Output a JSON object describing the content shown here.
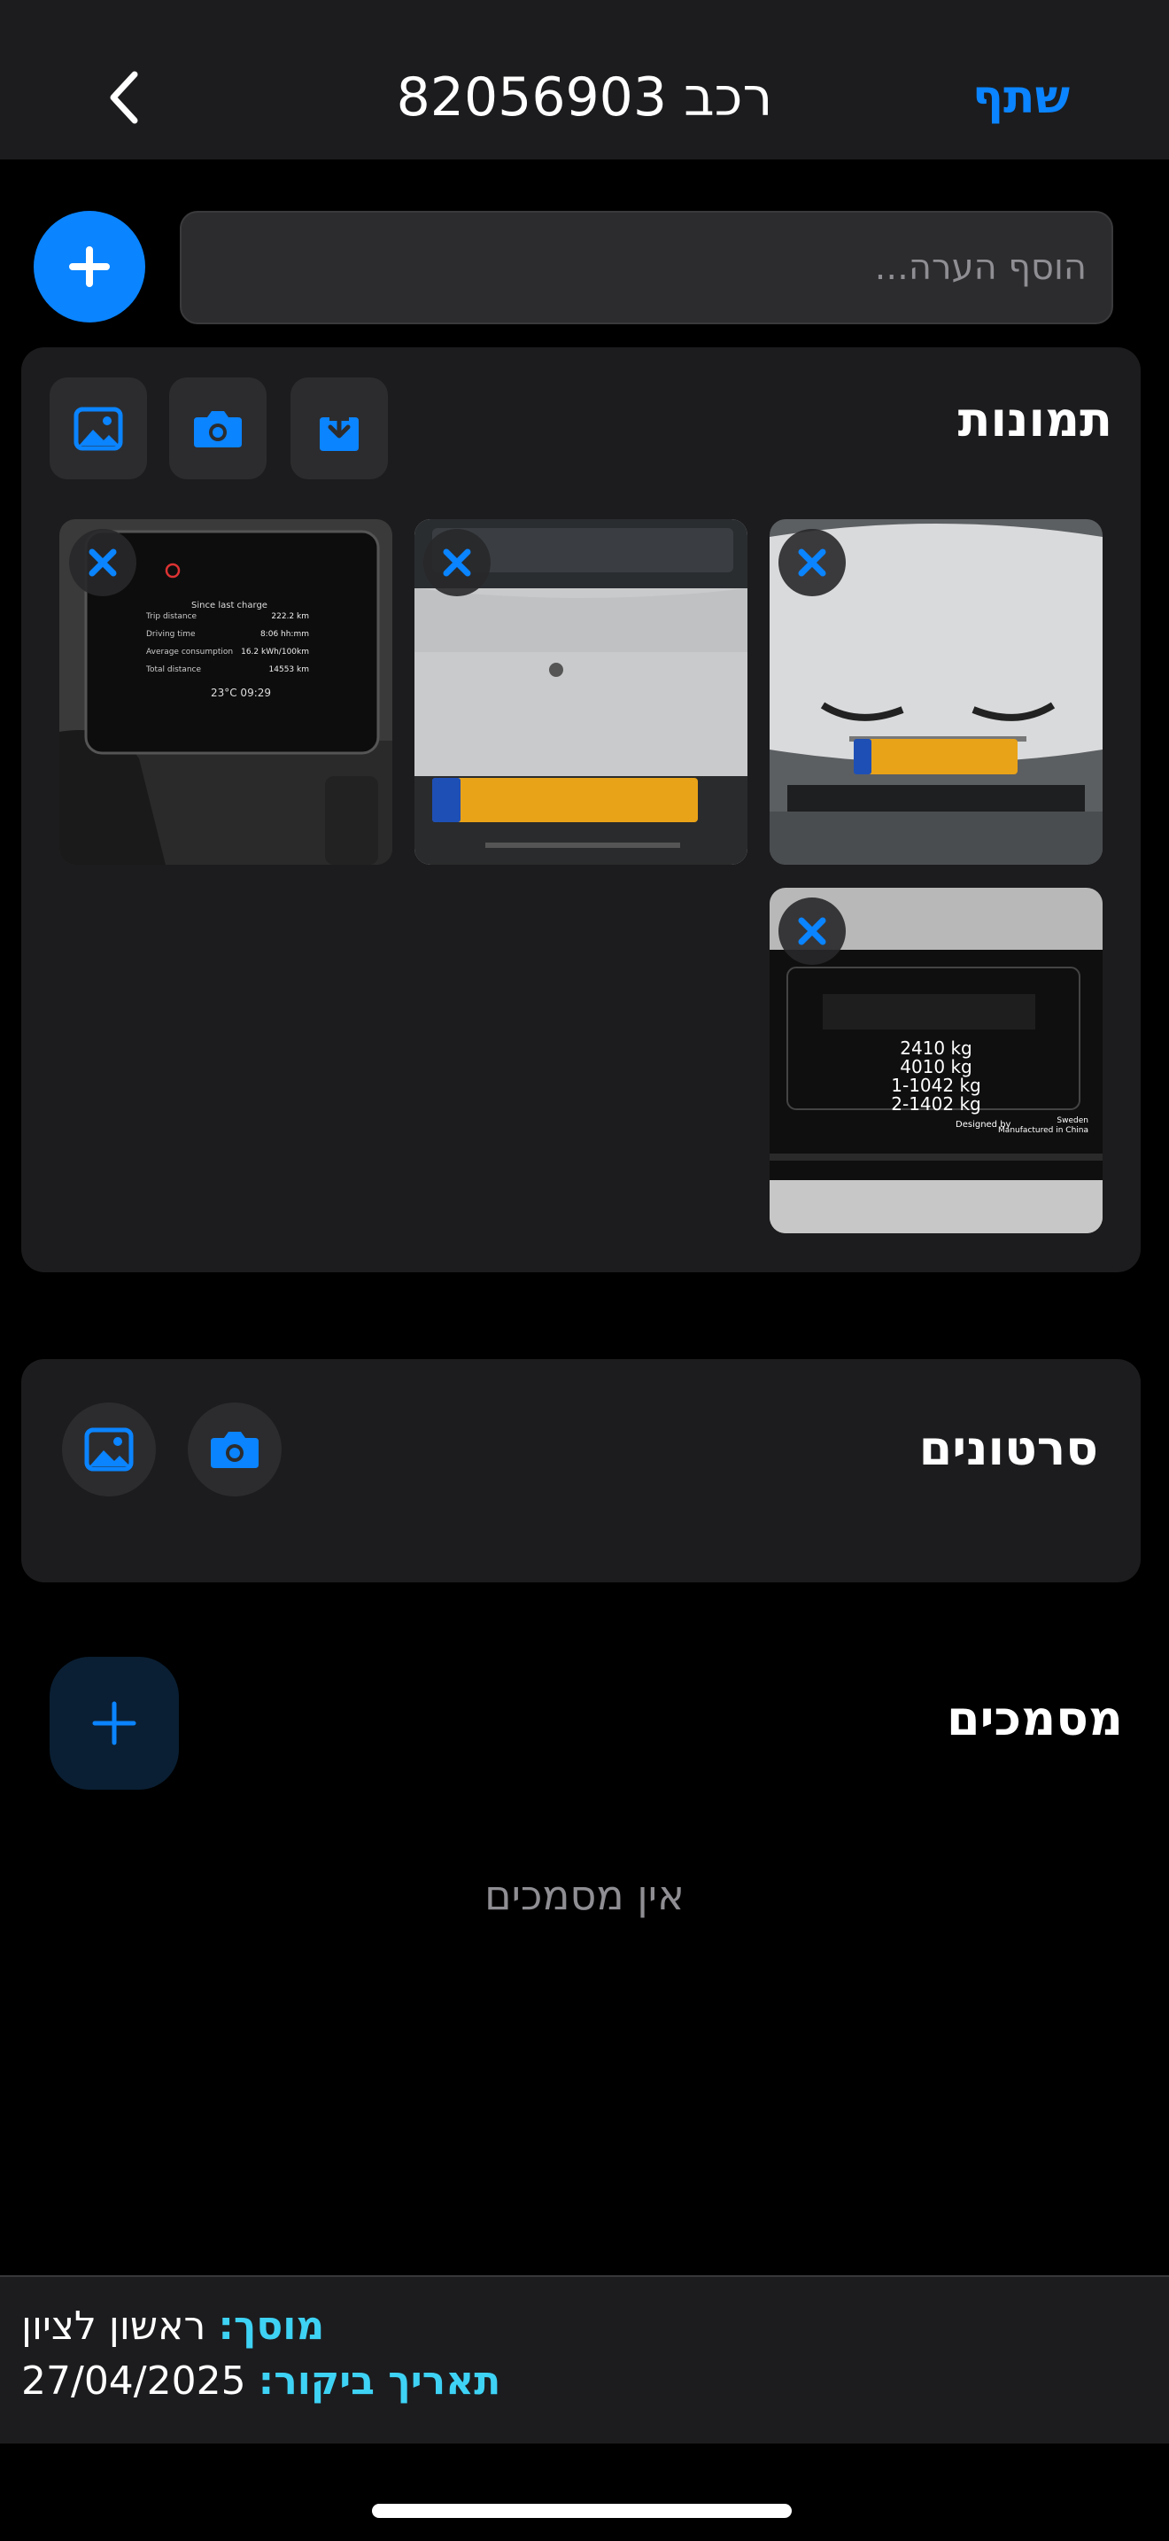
{
  "header": {
    "title": "רכב 82056903",
    "share_label": "שתף",
    "back_icon": "chevron-left-icon"
  },
  "note": {
    "placeholder": "הוסף הערה..."
  },
  "photos": {
    "title": "תמונות",
    "buttons": [
      "gallery-icon",
      "camera-icon",
      "download-icon"
    ],
    "items": [
      {
        "description": "dashboard"
      },
      {
        "description": "car-rear"
      },
      {
        "description": "car-front"
      },
      {
        "description": "weight-label"
      }
    ],
    "dashboard_text": {
      "header": "Since last charge",
      "rows": [
        [
          "Trip distance",
          "222.2 km"
        ],
        [
          "Driving time",
          "8:06 hh:mm"
        ],
        [
          "Average consumption",
          "16.2 kWh/100km"
        ],
        [
          "Total distance",
          "14553 km"
        ]
      ],
      "footer": "23°C  09:29"
    },
    "label_text": {
      "lines": [
        "2410 kg",
        "4010 kg",
        "1-1042 kg",
        "2-1402 kg"
      ],
      "designed": "Designed by",
      "sweden": "Sweden",
      "manufactured": "Manufactured in China"
    }
  },
  "videos": {
    "title": "סרטונים"
  },
  "documents": {
    "title": "מסמכים",
    "empty_text": "אין מסמכים"
  },
  "footer": {
    "garage_label": "מוסך:",
    "garage_value": "ראשון לציון",
    "date_label": "תאריך ביקור:",
    "date_value": "27/04/2025"
  },
  "colors": {
    "accent": "#0a84ff",
    "footer_label": "#3ed2f5",
    "background": "#000000",
    "card": "#1c1c1e"
  }
}
